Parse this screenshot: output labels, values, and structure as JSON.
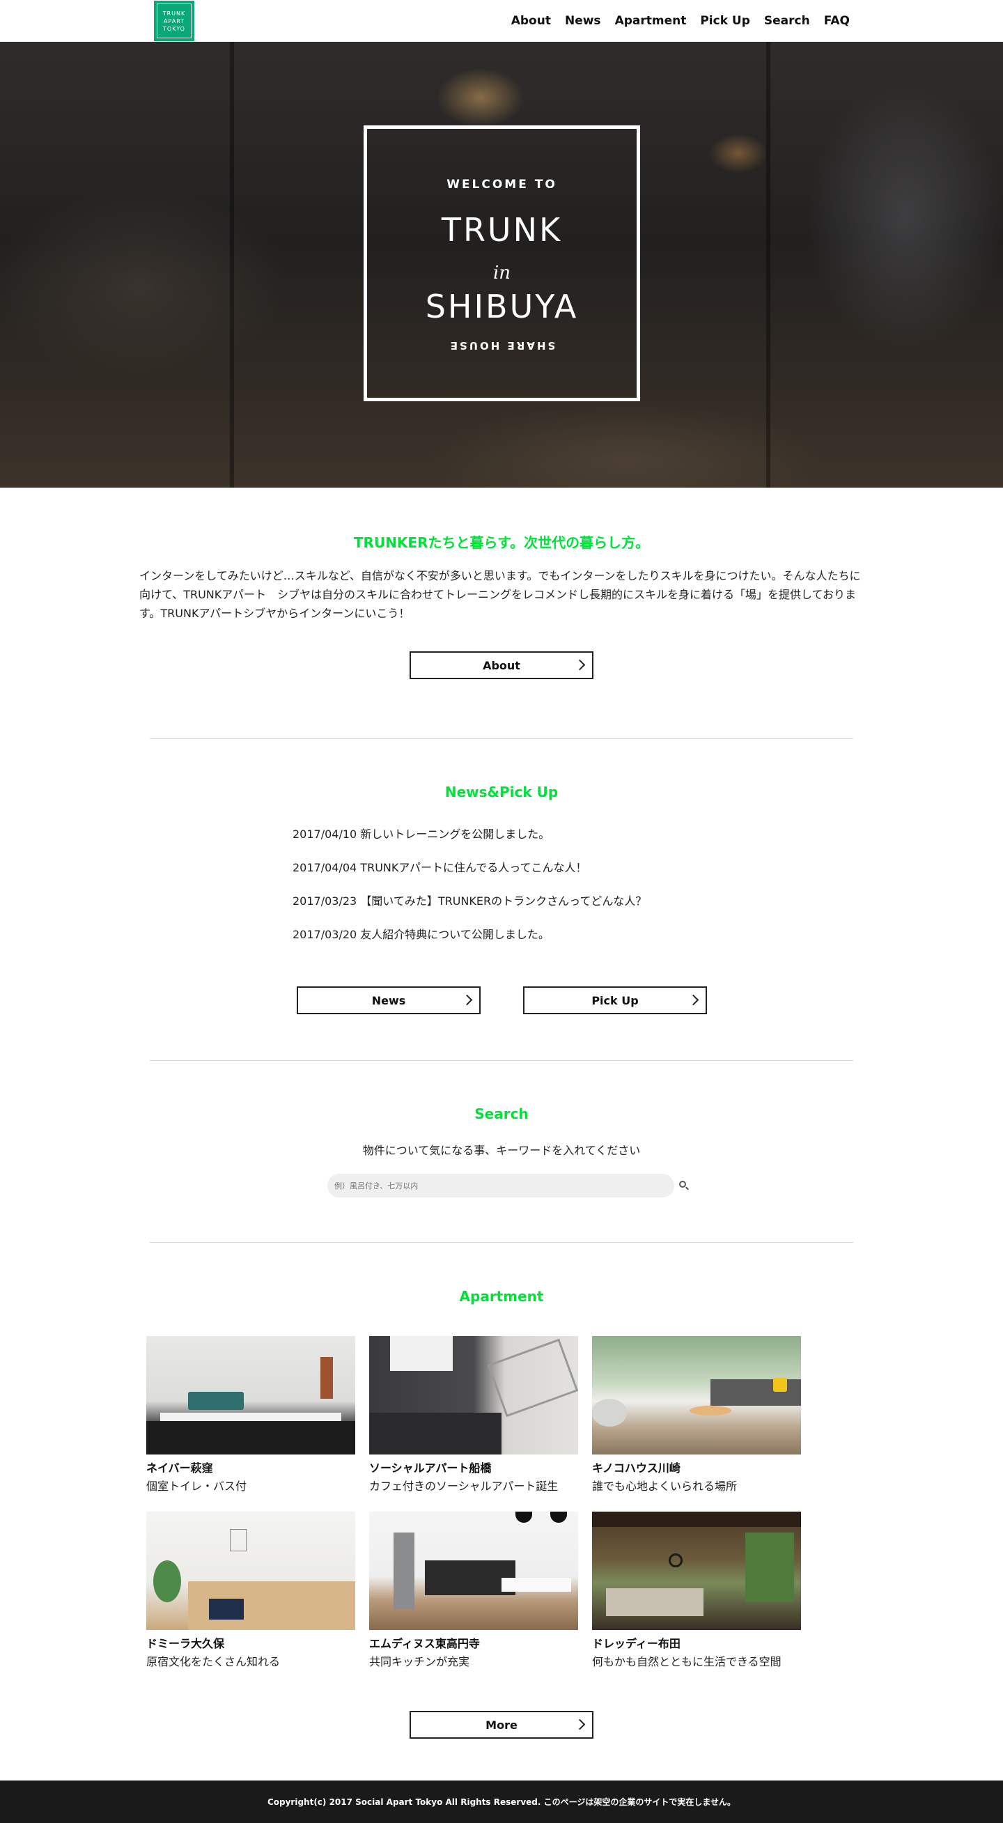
{
  "header": {
    "logo_lines": [
      "TRUNK",
      "APART",
      "TOKYO"
    ],
    "nav": [
      "About",
      "News",
      "Apartment",
      "Pick Up",
      "Search",
      "FAQ"
    ]
  },
  "hero": {
    "welcome": "WELCOME TO",
    "trunk": "TRUNK",
    "in": "in",
    "shibuya": "SHIBUYA",
    "share_house": "SHARE HOUSE"
  },
  "intro": {
    "title": "TRUNKERたちと暮らす。次世代の暮らし方。",
    "text": "インターンをしてみたいけど…スキルなど、自信がなく不安が多いと思います。でもインターンをしたりスキルを身につけたい。そんな人たちに向けて、TRUNKアパート　シブヤは自分のスキルに合わせてトレーニングをレコメンドし長期的にスキルを身に着ける「場」を提供しております。TRUNKアパートシブヤからインターンにいこう！",
    "button": "About"
  },
  "news": {
    "title": "News&Pick Up",
    "items": [
      "2017/04/10 新しいトレーニングを公開しました。",
      "2017/04/04 TRUNKアパートに住んでる人ってこんな人！",
      "2017/03/23 【聞いてみた】TRUNKERのトランクさんってどんな人？",
      "2017/03/20 友人紹介特典について公開しました。"
    ],
    "news_button": "News",
    "pickup_button": "Pick Up"
  },
  "search": {
    "title": "Search",
    "description": "物件について気になる事、キーワードを入れてください",
    "placeholder": "例）風呂付き、七万以内"
  },
  "apartment": {
    "title": "Apartment",
    "items": [
      {
        "name": "ネイバー萩窪",
        "desc": "個室トイレ・バス付"
      },
      {
        "name": "ソーシャルアパート船橋",
        "desc": "カフェ付きのソーシャルアパート誕生"
      },
      {
        "name": "キノコハウス川崎",
        "desc": "誰でも心地よくいられる場所"
      },
      {
        "name": "ドミーラ大久保",
        "desc": "原宿文化をたくさん知れる"
      },
      {
        "name": "エムディヌス東高円寺",
        "desc": "共同キッチンが充実"
      },
      {
        "name": "ドレッディー布田",
        "desc": "何もかも自然とともに生活できる空間"
      }
    ],
    "more_button": "More"
  },
  "footer": {
    "copyright": "Copyright(c) 2017 Social Apart Tokyo All Rights Reserved. このページは架空の企業のサイトで実在しません。"
  },
  "colors": {
    "accent": "#00e23a",
    "logo": "#0aa878",
    "footer": "#1a1a1a"
  }
}
